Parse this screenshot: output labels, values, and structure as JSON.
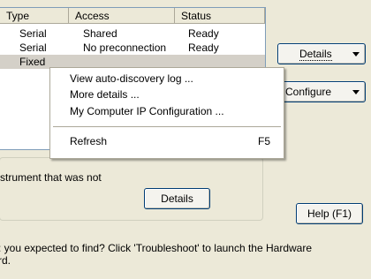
{
  "list": {
    "headers": [
      "Type",
      "Access",
      "Status"
    ],
    "rows": [
      {
        "type": "Serial",
        "access": "Shared",
        "status": "Ready"
      },
      {
        "type": "Serial",
        "access": "No preconnection",
        "status": "Ready"
      },
      {
        "type": "Fixed",
        "access": "",
        "status": ""
      }
    ]
  },
  "buttons": {
    "details_split": "Details",
    "configure": "Configure",
    "details": "Details",
    "help": "Help (F1)"
  },
  "groupbox": {
    "text": "strument that was not"
  },
  "footer": {
    "line1": ": you expected to find?  Click 'Troubleshoot' to launch the Hardware",
    "line2": "rd."
  },
  "context_menu": {
    "items": [
      {
        "label": "View auto-discovery log ..."
      },
      {
        "label": "More details ..."
      },
      {
        "label": "My Computer IP Configuration ..."
      }
    ],
    "refresh": {
      "label": "Refresh",
      "shortcut": "F5"
    }
  }
}
